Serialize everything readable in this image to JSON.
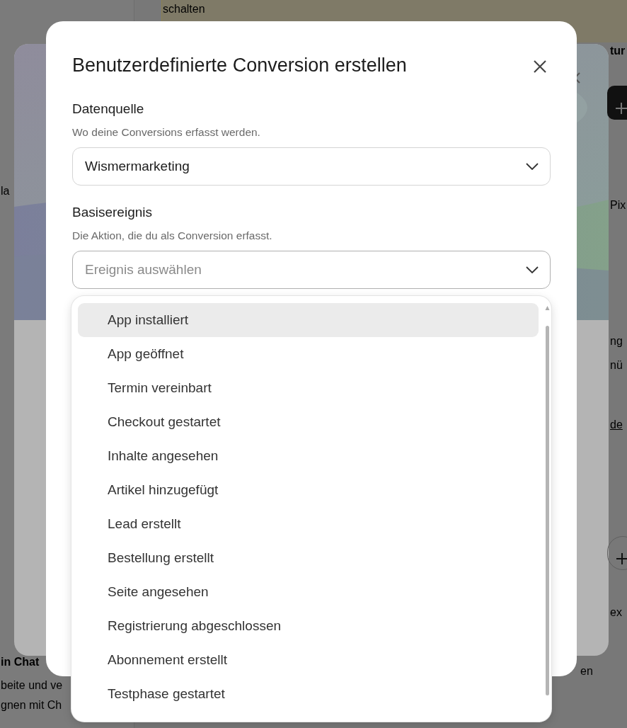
{
  "background": {
    "fragments": [
      {
        "text": "schalten",
        "kind": "text"
      },
      {
        "text": "tur",
        "kind": "bold"
      },
      {
        "text": "la",
        "kind": "text"
      },
      {
        "text": "Pix",
        "kind": "text"
      },
      {
        "text": "ng",
        "kind": "text"
      },
      {
        "text": "nü",
        "kind": "text"
      },
      {
        "text": "de",
        "kind": "link"
      },
      {
        "text": "ex",
        "kind": "text"
      },
      {
        "text": "in Chat",
        "kind": "bold"
      },
      {
        "text": "beite und ve",
        "kind": "text"
      },
      {
        "text": "gnen mit Ch",
        "kind": "text"
      },
      {
        "text": "en",
        "kind": "text"
      }
    ]
  },
  "dialog": {
    "title": "Benutzerdefinierte Conversion erstellen",
    "fields": [
      {
        "label": "Datenquelle",
        "hint": "Wo deine Conversions erfasst werden.",
        "value": "Wismermarketing",
        "expanded": false
      },
      {
        "label": "Basisereignis",
        "hint": "Die Aktion, die du als Conversion erfasst.",
        "placeholder": "Ereignis auswählen",
        "expanded": true
      }
    ],
    "options": [
      {
        "label": "App installiert",
        "selected": true
      },
      {
        "label": "App geöffnet",
        "selected": false
      },
      {
        "label": "Termin vereinbart",
        "selected": false
      },
      {
        "label": "Checkout gestartet",
        "selected": false
      },
      {
        "label": "Inhalte angesehen",
        "selected": false
      },
      {
        "label": "Artikel hinzugefügt",
        "selected": false
      },
      {
        "label": "Lead erstellt",
        "selected": false
      },
      {
        "label": "Bestellung erstellt",
        "selected": false
      },
      {
        "label": "Seite angesehen",
        "selected": false
      },
      {
        "label": "Registrierung abgeschlossen",
        "selected": false
      },
      {
        "label": "Abonnement erstellt",
        "selected": false
      },
      {
        "label": "Testphase gestartet",
        "selected": false
      }
    ]
  }
}
